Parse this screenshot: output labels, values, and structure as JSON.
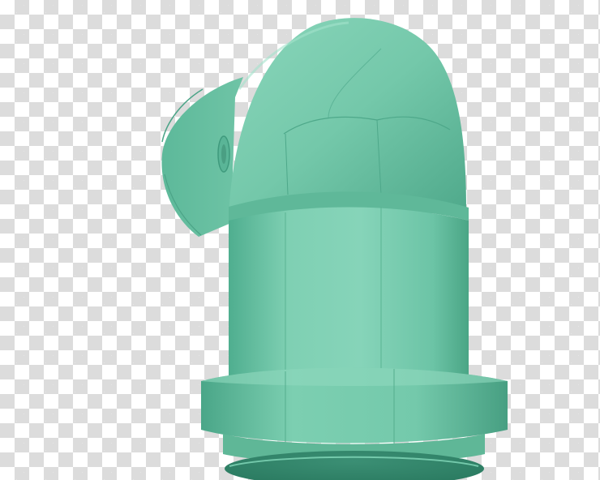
{
  "image": {
    "subject": "pipe-elbow-fitting",
    "background": "transparency-checkerboard"
  },
  "colors": {
    "pipe_base": "#6cc4a6",
    "pipe_light": "#8ad6bb",
    "pipe_dark": "#3f9d80",
    "pipe_shadow": "#2f8369",
    "checker_dark": "#dcdcdc",
    "checker_light": "#ffffff"
  }
}
